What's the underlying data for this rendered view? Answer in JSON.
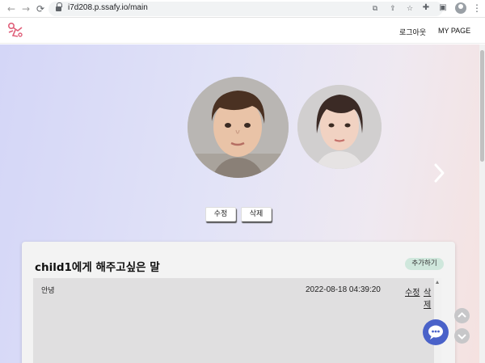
{
  "browser": {
    "url": "i7d208.p.ssafy.io/main",
    "icons": [
      "back-icon",
      "forward-icon",
      "reload-icon",
      "lock-icon",
      "translate-icon",
      "share-icon",
      "star-icon",
      "extensions-icon",
      "side-panel-icon",
      "profile-icon",
      "menu-icon"
    ]
  },
  "header": {
    "logout_label": "로그아웃",
    "mypage_label": "MY PAGE"
  },
  "carousel": {
    "children": [
      "child1-photo",
      "child2-photo"
    ]
  },
  "actions": {
    "edit_label": "수정",
    "delete_label": "삭제"
  },
  "card": {
    "title": "child1에게 해주고싶은 말",
    "add_label": "추가하기",
    "messages": [
      {
        "text": "안녕",
        "date": "2022-08-18 04:39:20",
        "edit_label": "수정",
        "delete_label": "삭제"
      }
    ]
  },
  "colors": {
    "accent_green": "#cfe7dc",
    "chat_blue": "#4a62c9",
    "hero_gradient_start": "#d4d6f7",
    "hero_gradient_end": "#f5e2e0"
  }
}
